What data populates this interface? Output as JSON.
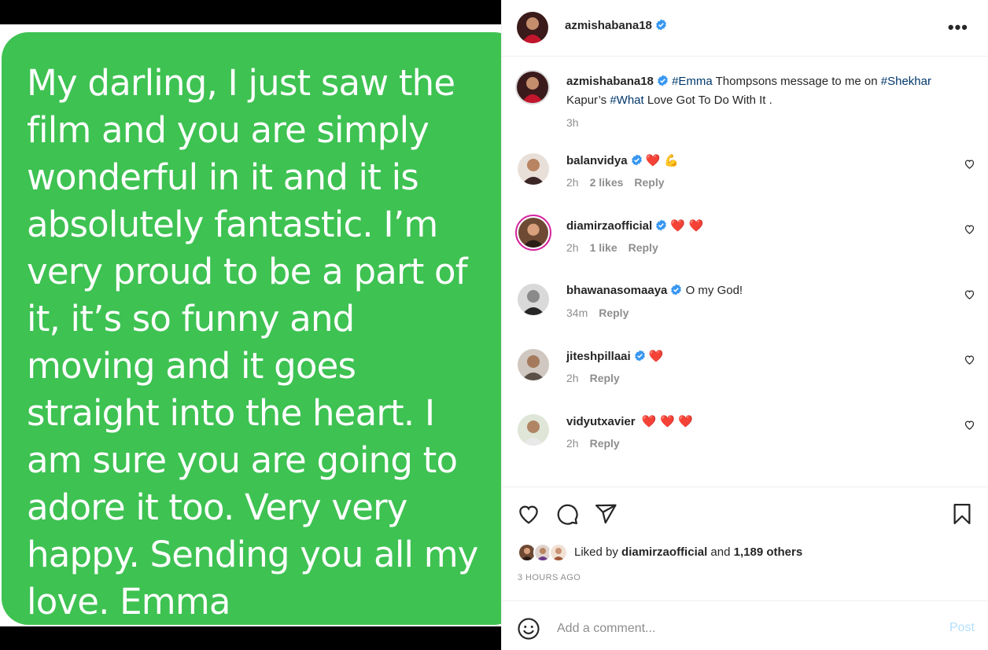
{
  "media": {
    "message_text": "My darling, I just saw the\nfilm and you are simply\nwonderful in it and it is\nabsolutely fantastic. I’m\nvery proud to be a part of\nit, it’s so funny and\nmoving and it goes\nstraight into the heart. I\nam sure you are going to\nadore it too. Very very\nhappy. Sending you all my\nlove. Emma"
  },
  "header": {
    "username": "azmishabana18"
  },
  "caption": {
    "username": "azmishabana18",
    "tag1": "#Emma",
    "text1": " Thompsons message to me on ",
    "tag2": "#Shekhar",
    "text2": " Kapur’s ",
    "tag3": "#What",
    "text3": " Love Got To Do With It .",
    "time": "3h"
  },
  "comments": [
    {
      "username": "balanvidya",
      "text": "❤️ 💪",
      "time": "2h",
      "likes": "2 likes",
      "reply": "Reply"
    },
    {
      "username": "diamirzaofficial",
      "text": "❤️ ❤️",
      "time": "2h",
      "likes": "1 like",
      "reply": "Reply"
    },
    {
      "username": "bhawanasomaaya",
      "text": "O my God!",
      "time": "34m",
      "likes": "",
      "reply": "Reply"
    },
    {
      "username": "jiteshpillaai",
      "text": "❤️",
      "time": "2h",
      "likes": "",
      "reply": "Reply"
    },
    {
      "username": "vidyutxavier",
      "text": "❤️ ❤️ ❤️",
      "time": "2h",
      "likes": "",
      "reply": "Reply"
    }
  ],
  "footer": {
    "liked_by_prefix": "Liked by ",
    "liked_by_user": "diamirzaofficial",
    "liked_by_and": " and ",
    "liked_by_others": "1,189 others",
    "time_ago": "3 HOURS AGO",
    "comment_placeholder": "Add a comment...",
    "post_label": "Post"
  },
  "colors": {
    "bubble_green": "#3ec252",
    "verified_blue": "#3897f0",
    "heart_red": "#ed4956",
    "hashtag_blue": "#00376b",
    "post_disabled": "#b2dffc"
  },
  "icons": [
    "more-options-icon",
    "verified-icon",
    "heart-icon",
    "comment-icon",
    "share-icon",
    "bookmark-icon",
    "emoji-icon"
  ]
}
